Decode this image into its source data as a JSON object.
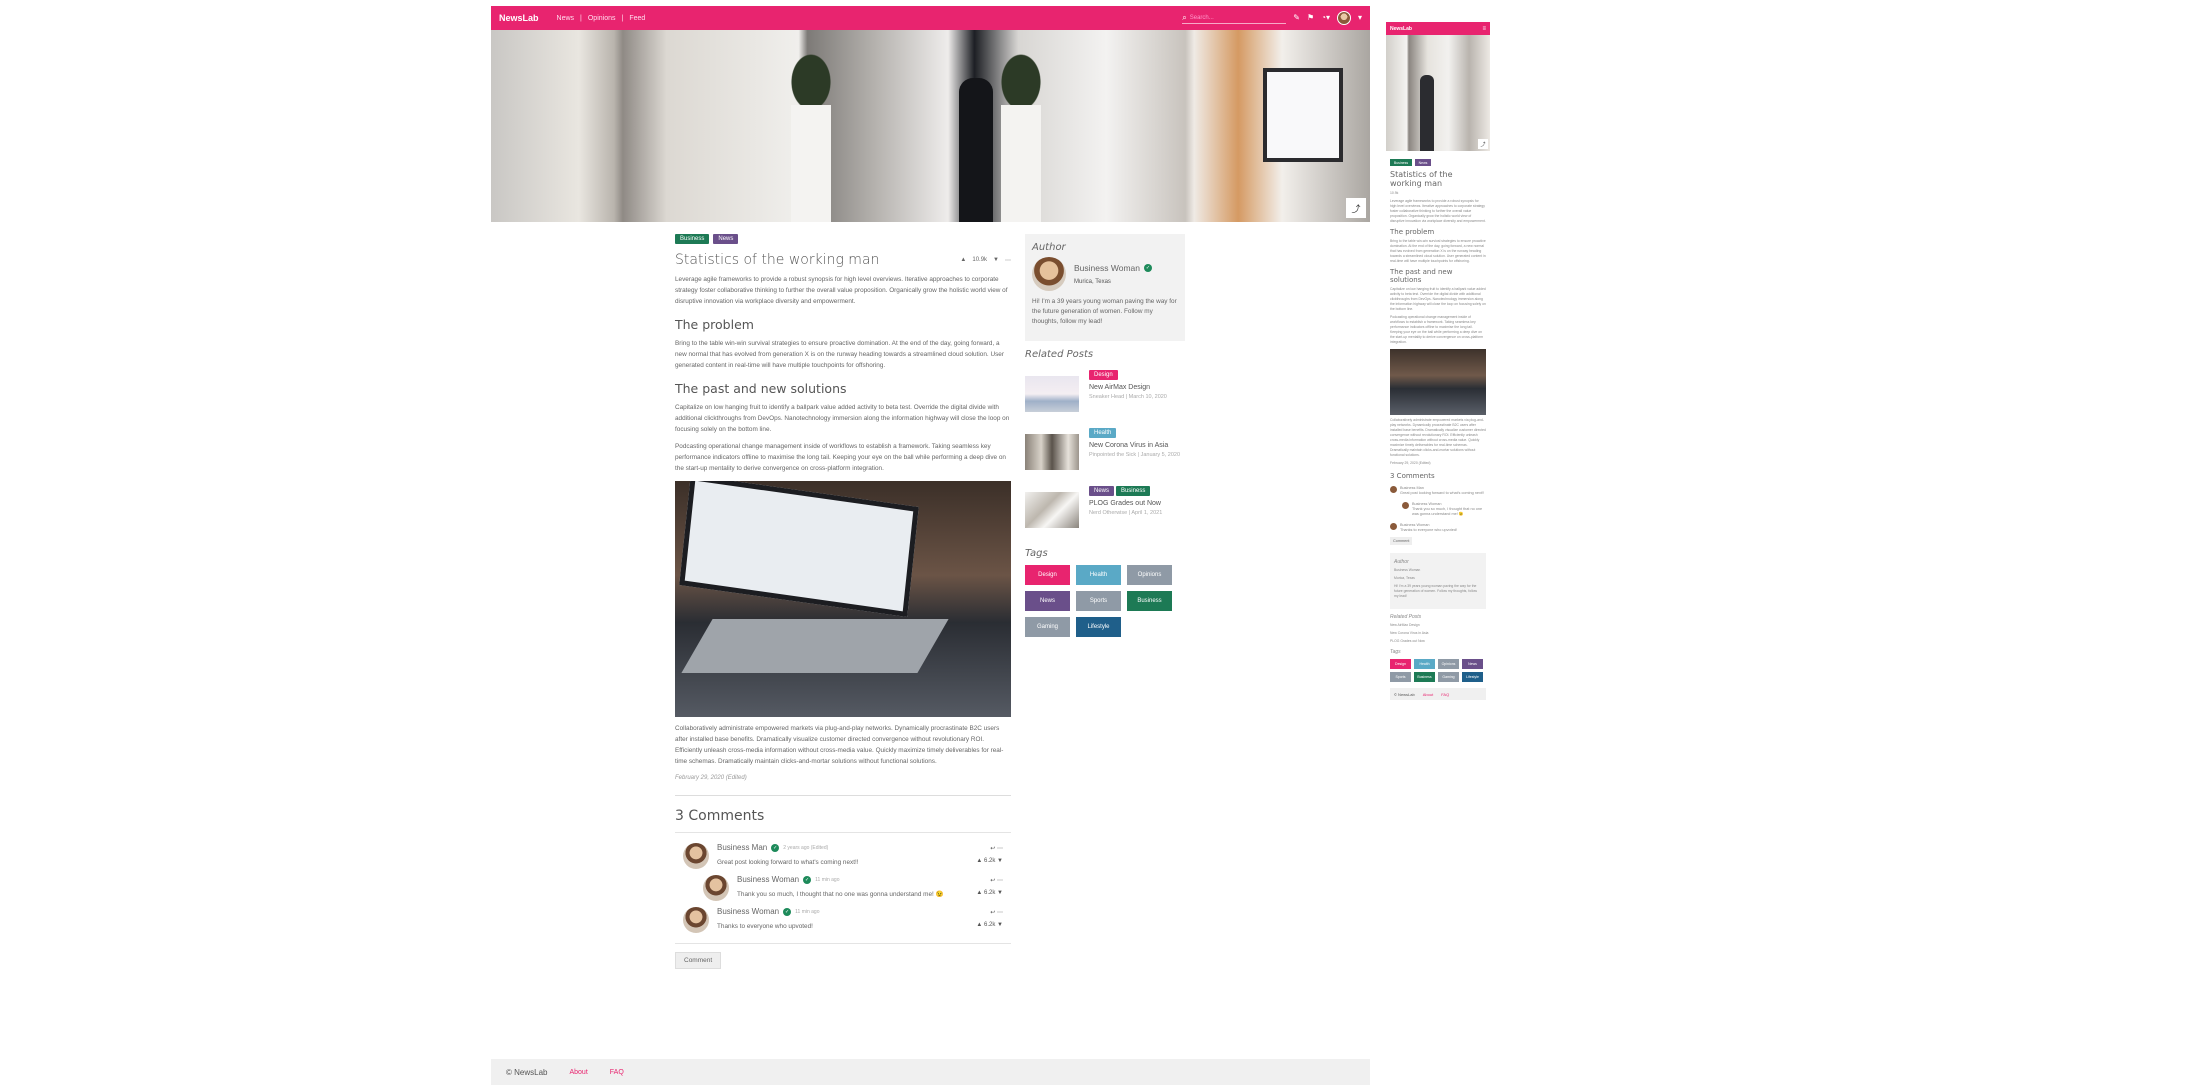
{
  "app": {
    "brand": "NewsLab"
  },
  "nav": {
    "links": [
      "News",
      "Opinions",
      "Feed"
    ],
    "separator": "|",
    "search_placeholder": "Search..."
  },
  "article": {
    "tags": [
      {
        "label": "Business",
        "color": "#1d7a55"
      },
      {
        "label": "News",
        "color": "#6a4f8a"
      }
    ],
    "title": "Statistics of the working man",
    "score": "10.9k",
    "intro": "Leverage agile frameworks to provide a robust synopsis for high level overviews. Iterative approaches to corporate strategy foster collaborative thinking to further the overall value proposition. Organically grow the holistic world view of disruptive innovation via workplace diversity and empowerment.",
    "h_problem": "The problem",
    "p_problem": "Bring to the table win-win survival strategies to ensure proactive domination. At the end of the day, going forward, a new normal that has evolved from generation X is on the runway heading towards a streamlined cloud solution. User generated content in real-time will have multiple touchpoints for offshoring.",
    "h_past": "The past and new solutions",
    "p_past1": "Capitalize on low hanging fruit to identify a ballpark value added activity to beta test. Override the digital divide with additional clickthroughs from DevOps. Nanotechnology immersion along the information highway will close the loop on focusing solely on the bottom line.",
    "p_past2": "Podcasting operational change management inside of workflows to establish a framework. Taking seamless key performance indicators offline to maximise the long tail. Keeping your eye on the ball while performing a deep dive on the start-up mentality to derive convergence on cross-platform integration.",
    "p_after": "Collaboratively administrate empowered markets via plug-and-play networks. Dynamically procrastinate B2C users after installed base benefits. Dramatically visualize customer directed convergence without revolutionary ROI. Efficiently unleash cross-media information without cross-media value. Quickly maximize timely deliverables for real-time schemas. Dramatically maintain clicks-and-mortar solutions without functional solutions.",
    "date": "February 29, 2020 (Edited)"
  },
  "comments": {
    "title": "3 Comments",
    "button": "Comment",
    "items": [
      {
        "name": "Business Man",
        "time": "2 years ago (Edited)",
        "text": "Great post looking forward to what's coming next!!",
        "score": "6.2k"
      },
      {
        "name": "Business Woman",
        "time": "11 min ago",
        "text": "Thank you so much, I thought that no one was gonna understand me! 😉",
        "score": "6.2k"
      },
      {
        "name": "Business Woman",
        "time": "11 min ago",
        "text": "Thanks to everyone who upvoted!",
        "score": "6.2k"
      }
    ]
  },
  "author": {
    "heading": "Author",
    "name": "Business Woman",
    "location": "Murica, Texas",
    "bio": "Hi! I'm a 39 years young woman paving the way for the future generation of women. Follow my thoughts, follow my lead!"
  },
  "related": {
    "heading": "Related Posts",
    "items": [
      {
        "tags": [
          {
            "label": "Design",
            "color": "#e8246f"
          }
        ],
        "title": "New AirMax Design",
        "date": "Sneaker Head | March 10, 2020"
      },
      {
        "tags": [
          {
            "label": "Health",
            "color": "#5aa9c6"
          }
        ],
        "title": "New Corona Virus in Asia",
        "date": "Pinpointed the Sick | January 5, 2020"
      },
      {
        "tags": [
          {
            "label": "News",
            "color": "#6a4f8a"
          },
          {
            "label": "Business",
            "color": "#1d7a55"
          }
        ],
        "title": "PLOG Grades out Now",
        "date": "Nerd Otherwise | April 1, 2021"
      }
    ]
  },
  "tags": {
    "heading": "Tags",
    "items": [
      {
        "label": "Design",
        "color": "#e8246f"
      },
      {
        "label": "Health",
        "color": "#5aa9c6"
      },
      {
        "label": "Opinions",
        "color": "#8f9aa6"
      },
      {
        "label": "News",
        "color": "#6a4f8a"
      },
      {
        "label": "Sports",
        "color": "#8f9aa6"
      },
      {
        "label": "Business",
        "color": "#1d7a55"
      },
      {
        "label": "Gaming",
        "color": "#8f9aa6"
      },
      {
        "label": "Lifestyle",
        "color": "#1f5f8a"
      }
    ]
  },
  "footer": {
    "copyright": "© NewsLab",
    "links": [
      "About",
      "FAQ"
    ]
  },
  "icons": {
    "search": "search-icon",
    "share": "share-icon",
    "reply": "reply-icon",
    "more": "more-icon",
    "upvote": "upvote-icon",
    "downvote": "downvote-icon",
    "verified": "verified-icon"
  }
}
